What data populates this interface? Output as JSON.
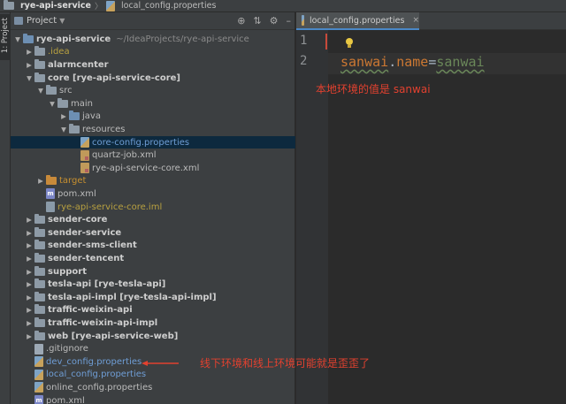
{
  "breadcrumb": {
    "project": "rye-api-service",
    "file": "local_config.properties"
  },
  "project_panel": {
    "title": "Project",
    "vertical_tab": "1: Project"
  },
  "tree": [
    {
      "depth": 0,
      "arrow": "down",
      "icon": "folder-blue",
      "label": "rye-api-service",
      "suffix": "~/IdeaProjects/rye-api-service",
      "style": "bold"
    },
    {
      "depth": 1,
      "arrow": "right",
      "icon": "folder",
      "label": ".idea",
      "style": "olive"
    },
    {
      "depth": 1,
      "arrow": "right",
      "icon": "folder",
      "label": "alarmcenter",
      "style": "bold"
    },
    {
      "depth": 1,
      "arrow": "down",
      "icon": "folder",
      "label": "core [rye-api-service-core]",
      "style": "bold"
    },
    {
      "depth": 2,
      "arrow": "down",
      "icon": "folder",
      "label": "src",
      "style": "gray"
    },
    {
      "depth": 3,
      "arrow": "down",
      "icon": "folder",
      "label": "main",
      "style": "gray"
    },
    {
      "depth": 4,
      "arrow": "right",
      "icon": "folder-blue",
      "label": "java",
      "style": "gray"
    },
    {
      "depth": 4,
      "arrow": "down",
      "icon": "folder",
      "label": "resources",
      "style": "gray"
    },
    {
      "depth": 5,
      "arrow": "none",
      "icon": "props",
      "label": "core-config.properties",
      "style": "blue",
      "selected": true
    },
    {
      "depth": 5,
      "arrow": "none",
      "icon": "xml",
      "label": "quartz-job.xml",
      "style": "gray"
    },
    {
      "depth": 5,
      "arrow": "none",
      "icon": "xml",
      "label": "rye-api-service-core.xml",
      "style": "gray"
    },
    {
      "depth": 2,
      "arrow": "right",
      "icon": "folder-orange",
      "label": "target",
      "style": "orange"
    },
    {
      "depth": 2,
      "arrow": "none",
      "icon": "pom",
      "label": "pom.xml",
      "style": "gray"
    },
    {
      "depth": 2,
      "arrow": "none",
      "icon": "iml",
      "label": "rye-api-service-core.iml",
      "style": "olive"
    },
    {
      "depth": 1,
      "arrow": "right",
      "icon": "folder",
      "label": "sender-core",
      "style": "bold"
    },
    {
      "depth": 1,
      "arrow": "right",
      "icon": "folder",
      "label": "sender-service",
      "style": "bold"
    },
    {
      "depth": 1,
      "arrow": "right",
      "icon": "folder",
      "label": "sender-sms-client",
      "style": "bold"
    },
    {
      "depth": 1,
      "arrow": "right",
      "icon": "folder",
      "label": "sender-tencent",
      "style": "bold"
    },
    {
      "depth": 1,
      "arrow": "right",
      "icon": "folder",
      "label": "support",
      "style": "bold"
    },
    {
      "depth": 1,
      "arrow": "right",
      "icon": "folder",
      "label": "tesla-api [rye-tesla-api]",
      "style": "bold"
    },
    {
      "depth": 1,
      "arrow": "right",
      "icon": "folder",
      "label": "tesla-api-impl [rye-tesla-api-impl]",
      "style": "bold"
    },
    {
      "depth": 1,
      "arrow": "right",
      "icon": "folder",
      "label": "traffic-weixin-api",
      "style": "bold"
    },
    {
      "depth": 1,
      "arrow": "right",
      "icon": "folder",
      "label": "traffic-weixin-api-impl",
      "style": "bold"
    },
    {
      "depth": 1,
      "arrow": "right",
      "icon": "folder",
      "label": "web [rye-api-service-web]",
      "style": "bold"
    },
    {
      "depth": 1,
      "arrow": "none",
      "icon": "file",
      "label": ".gitignore",
      "style": "gray"
    },
    {
      "depth": 1,
      "arrow": "none",
      "icon": "props",
      "label": "dev_config.properties",
      "style": "blue"
    },
    {
      "depth": 1,
      "arrow": "none",
      "icon": "props",
      "label": "local_config.properties",
      "style": "blue"
    },
    {
      "depth": 1,
      "arrow": "none",
      "icon": "props",
      "label": "online_config.properties",
      "style": "gray"
    },
    {
      "depth": 1,
      "arrow": "none",
      "icon": "pom",
      "label": "pom.xml",
      "style": "gray"
    }
  ],
  "editor": {
    "tab_label": "local_config.properties",
    "line_numbers": [
      "1",
      "2"
    ],
    "code": {
      "key_a": "sanwai",
      "dot": ".",
      "key_b": "name",
      "eq": "=",
      "value": "sanwai"
    }
  },
  "annotations": {
    "editor_note": "本地环境的值是 sanwai",
    "tree_note": "线下环境和线上环境可能就是歪歪了"
  },
  "colors": {
    "annotation": "#e2412f",
    "selection": "#0d293e",
    "accent": "#4a88c7"
  }
}
